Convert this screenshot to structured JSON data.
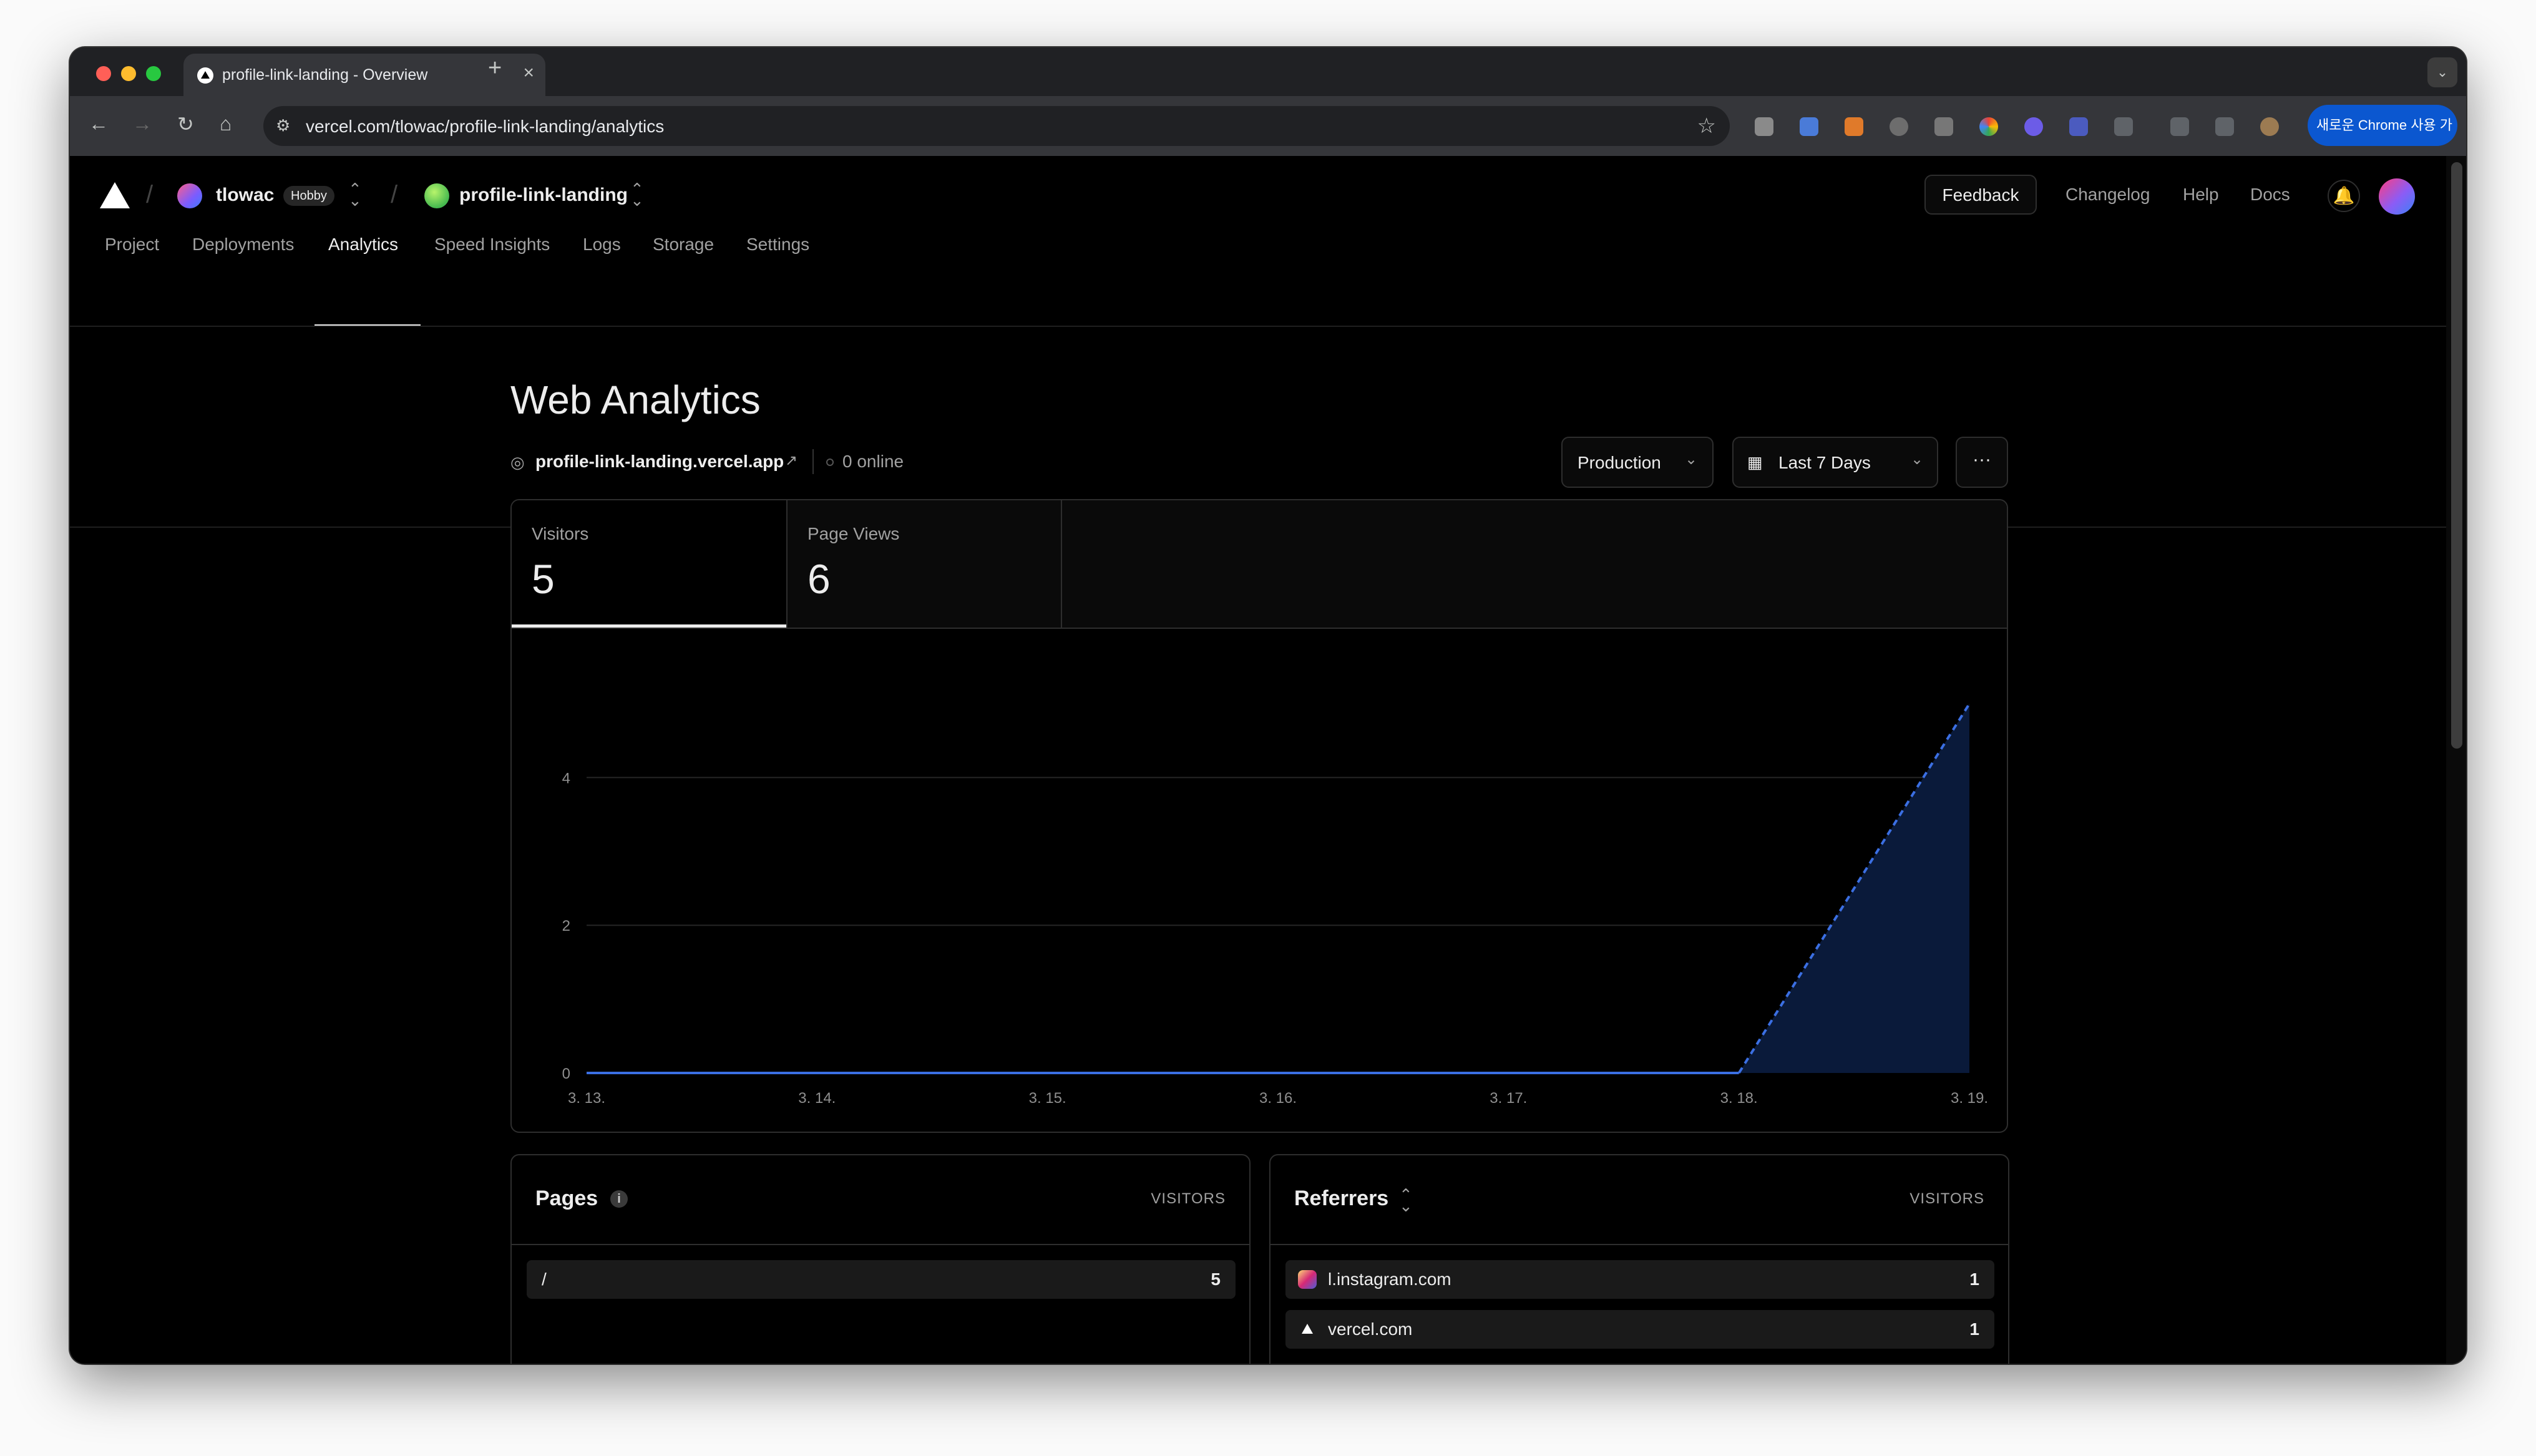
{
  "browser": {
    "tab_title": "profile-link-landing - Overview",
    "url": "vercel.com/tlowac/profile-link-landing/analytics",
    "update_button": "새로운 Chrome 사용 가능 ⋮"
  },
  "header": {
    "team_name": "tlowac",
    "team_plan": "Hobby",
    "project_name": "profile-link-landing",
    "feedback": "Feedback",
    "changelog": "Changelog",
    "help": "Help",
    "docs": "Docs"
  },
  "nav": {
    "tabs": [
      {
        "label": "Project"
      },
      {
        "label": "Deployments"
      },
      {
        "label": "Analytics"
      },
      {
        "label": "Speed Insights"
      },
      {
        "label": "Logs"
      },
      {
        "label": "Storage"
      },
      {
        "label": "Settings"
      }
    ],
    "active": "Analytics"
  },
  "page": {
    "title": "Web Analytics",
    "domain": "profile-link-landing.vercel.app",
    "online": "0 online",
    "environment": "Production",
    "range": "Last 7 Days",
    "more": "···"
  },
  "stats": {
    "visitors_label": "Visitors",
    "visitors_value": "5",
    "pageviews_label": "Page Views",
    "pageviews_value": "6"
  },
  "chart_data": {
    "type": "area",
    "title": "",
    "xlabel": "",
    "ylabel": "",
    "x": [
      "3. 13.",
      "3. 14.",
      "3. 15.",
      "3. 16.",
      "3. 17.",
      "3. 18.",
      "3. 19."
    ],
    "series": [
      {
        "values": [
          0,
          0,
          0,
          0,
          0,
          0,
          5
        ]
      }
    ],
    "ylim": [
      0,
      5
    ],
    "yticks": [
      0,
      2,
      4
    ],
    "grid": true,
    "last_segment_dashed": true,
    "line_color": "#3b6fe3",
    "fill_color": "#0a1a3a"
  },
  "pages_card": {
    "title": "Pages",
    "column": "VISITORS",
    "rows": [
      {
        "label": "/",
        "value": "5"
      }
    ]
  },
  "referrers_card": {
    "title": "Referrers",
    "column": "VISITORS",
    "rows": [
      {
        "label": "l.instagram.com",
        "value": "1",
        "icon": "instagram-icon"
      },
      {
        "label": "vercel.com",
        "value": "1",
        "icon": "vercel-icon"
      }
    ]
  },
  "colors": {
    "background": "#000000",
    "accent": "#3b6fe3",
    "chrome_update": "#0b57d0"
  }
}
